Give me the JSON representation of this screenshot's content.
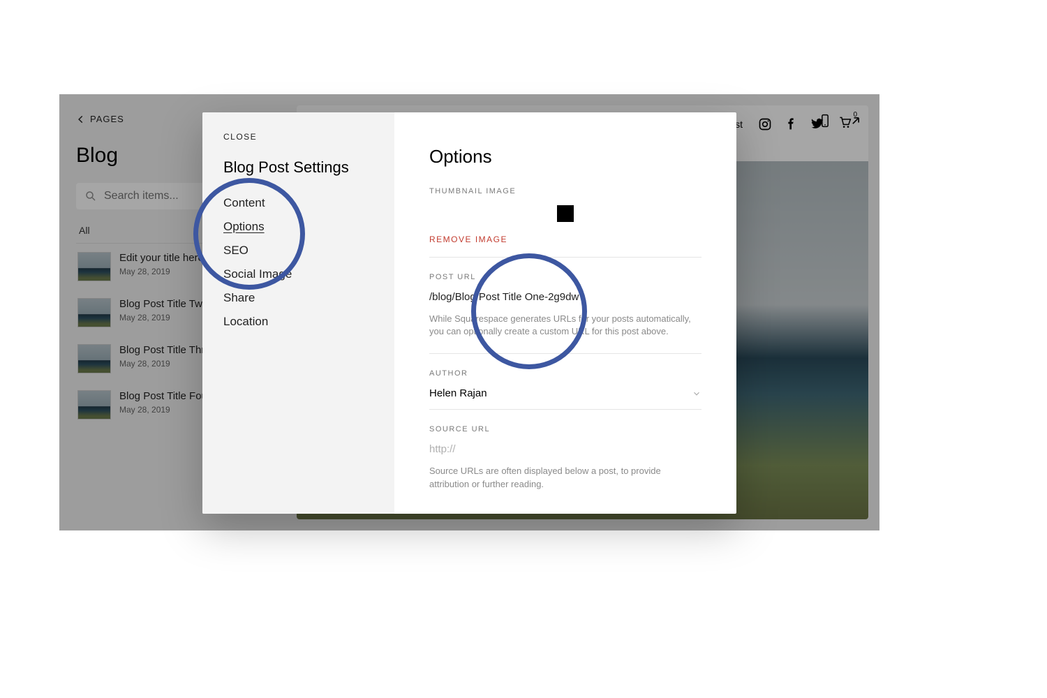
{
  "back_label": "PAGES",
  "page_title": "Blog",
  "search_placeholder": "Search items...",
  "filter_label": "All",
  "posts": [
    {
      "title": "Edit your title here",
      "date": "May 28, 2019"
    },
    {
      "title": "Blog Post Title Two",
      "date": "May 28, 2019"
    },
    {
      "title": "Blog Post Title Three",
      "date": "May 28, 2019"
    },
    {
      "title": "Blog Post Title Four",
      "date": "May 28, 2019"
    }
  ],
  "preview": {
    "brand_text": "Test",
    "cart_count": "0"
  },
  "modal": {
    "close_label": "CLOSE",
    "title": "Blog Post Settings",
    "nav": {
      "content": "Content",
      "options": "Options",
      "seo": "SEO",
      "social_image": "Social Image",
      "share": "Share",
      "location": "Location"
    },
    "body_title": "Options",
    "thumb_label": "THUMBNAIL IMAGE",
    "remove_image": "REMOVE IMAGE",
    "post_url_label": "POST URL",
    "post_url_value": "/blog/Blog Post Title One-2g9dw",
    "post_url_help": "While Squarespace generates URLs for your posts automatically, you can optionally create a custom URL for this post above.",
    "author_label": "AUTHOR",
    "author_value": "Helen Rajan",
    "source_label": "SOURCE URL",
    "source_placeholder": "http://",
    "source_help": "Source URLs are often displayed below a post, to provide attribution or further reading."
  }
}
